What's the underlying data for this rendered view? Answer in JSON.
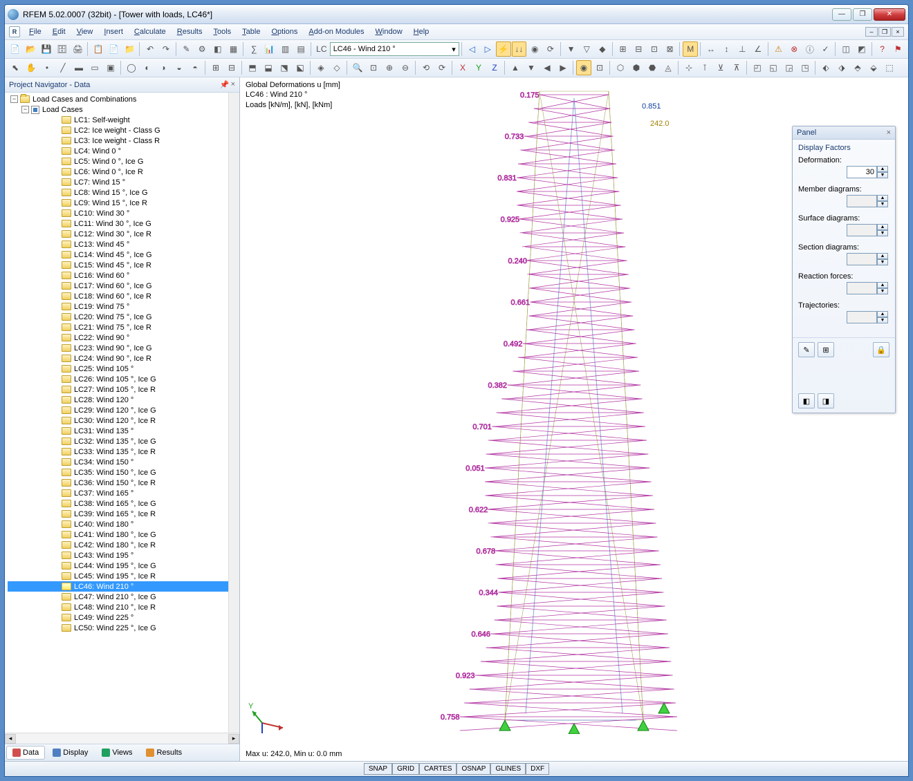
{
  "window": {
    "title": "RFEM 5.02.0007 (32bit) - [Tower with loads, LC46*]"
  },
  "menu": [
    "File",
    "Edit",
    "View",
    "Insert",
    "Calculate",
    "Results",
    "Tools",
    "Table",
    "Options",
    "Add-on Modules",
    "Window",
    "Help"
  ],
  "lc_combo": "LC46 - Wind 210 °",
  "navigator": {
    "title": "Project Navigator - Data",
    "root": "Load Cases and Combinations",
    "group": "Load Cases",
    "items": [
      "LC1: Self-weight",
      "LC2: Ice weight - Class G",
      "LC3: Ice weight - Class R",
      "LC4: Wind 0 °",
      "LC5: Wind 0 °, Ice G",
      "LC6: Wind 0 °, Ice R",
      "LC7: Wind 15 °",
      "LC8: Wind 15 °, Ice G",
      "LC9: Wind 15 °, Ice R",
      "LC10: Wind 30 °",
      "LC11: Wind 30 °, Ice G",
      "LC12: Wind 30 °, Ice R",
      "LC13: Wind 45 °",
      "LC14: Wind 45 °, Ice G",
      "LC15: Wind 45 °, Ice R",
      "LC16: Wind 60 °",
      "LC17: Wind 60 °, Ice G",
      "LC18: Wind 60 °, Ice R",
      "LC19: Wind 75 °",
      "LC20: Wind 75 °, Ice G",
      "LC21: Wind 75 °, Ice R",
      "LC22: Wind 90 °",
      "LC23: Wind 90 °, Ice G",
      "LC24: Wind 90 °, Ice R",
      "LC25: Wind 105 °",
      "LC26: Wind 105 °, Ice G",
      "LC27: Wind 105 °, Ice R",
      "LC28: Wind 120 °",
      "LC29: Wind 120 °, Ice G",
      "LC30: Wind 120 °, Ice R",
      "LC31: Wind 135 °",
      "LC32: Wind 135 °, Ice G",
      "LC33: Wind 135 °, Ice R",
      "LC34: Wind 150 °",
      "LC35: Wind 150 °, Ice G",
      "LC36: Wind 150 °, Ice R",
      "LC37: Wind 165 °",
      "LC38: Wind 165 °, Ice G",
      "LC39: Wind 165 °, Ice R",
      "LC40: Wind 180 °",
      "LC41: Wind 180 °, Ice G",
      "LC42: Wind 180 °, Ice R",
      "LC43: Wind 195 °",
      "LC44: Wind 195 °, Ice G",
      "LC45: Wind 195 °, Ice R",
      "LC46: Wind 210 °",
      "LC47: Wind 210 °, Ice G",
      "LC48: Wind 210 °, Ice R",
      "LC49: Wind 225 °",
      "LC50: Wind 225 °, Ice G"
    ],
    "selected_index": 45,
    "tabs": [
      "Data",
      "Display",
      "Views",
      "Results"
    ],
    "tab_icons": [
      "#d05050",
      "#5080c0",
      "#20a060",
      "#e09030"
    ]
  },
  "viewport": {
    "line1": "Global Deformations u [mm]",
    "line2": "LC46 : Wind 210 °",
    "line3": "Loads [kN/m], [kN], [kNm]",
    "footer": "Max u: 242.0, Min u: 0.0 mm",
    "axis": {
      "x": "X",
      "y": "Y",
      "z": "Z"
    },
    "max_value_label": "242.0"
  },
  "panel": {
    "title": "Panel",
    "section": "Display Factors",
    "factors": [
      {
        "label": "Deformation:",
        "value": "30",
        "enabled": true
      },
      {
        "label": "Member diagrams:",
        "value": "",
        "enabled": false
      },
      {
        "label": "Surface diagrams:",
        "value": "",
        "enabled": false
      },
      {
        "label": "Section diagrams:",
        "value": "",
        "enabled": false
      },
      {
        "label": "Reaction forces:",
        "value": "",
        "enabled": false
      },
      {
        "label": "Trajectories:",
        "value": "",
        "enabled": false
      }
    ]
  },
  "statusbar": [
    "SNAP",
    "GRID",
    "CARTES",
    "OSNAP",
    "GLINES",
    "DXF"
  ]
}
